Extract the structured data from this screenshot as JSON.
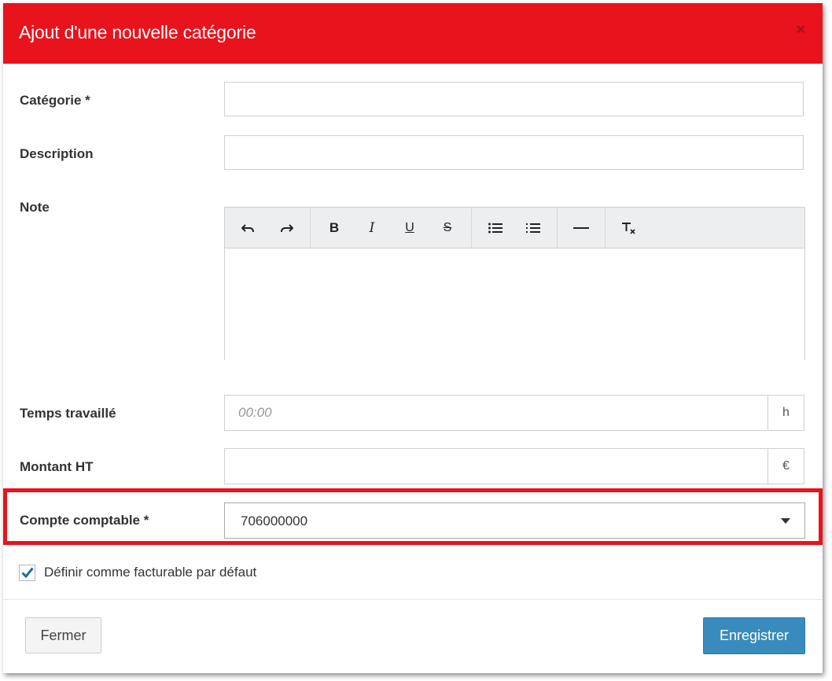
{
  "modal": {
    "title": "Ajout d'une nouvelle catégorie",
    "close_label": "×"
  },
  "form": {
    "category": {
      "label": "Catégorie *",
      "value": ""
    },
    "description": {
      "label": "Description",
      "value": ""
    },
    "note": {
      "label": "Note",
      "toolbar": [
        "undo-icon",
        "redo-icon",
        "bold-icon",
        "italic-icon",
        "underline-icon",
        "strikethrough-icon",
        "bullet-list-icon",
        "numbered-list-icon",
        "horizontal-rule-icon",
        "clear-formatting-icon"
      ],
      "content": ""
    },
    "time_worked": {
      "label": "Temps travaillé",
      "placeholder": "00:00",
      "unit": "h"
    },
    "amount": {
      "label": "Montant HT",
      "value": "",
      "unit": "€"
    },
    "account": {
      "label": "Compte comptable *",
      "value": "706000000"
    },
    "billable": {
      "label": "Définir comme facturable par défaut",
      "checked": true
    }
  },
  "footer": {
    "close_label": "Fermer",
    "save_label": "Enregistrer"
  },
  "colors": {
    "header": "#e8131d",
    "highlight": "#e8131d",
    "primary_button": "#3a8bbd",
    "checkbox_check": "#1a6fa8"
  }
}
